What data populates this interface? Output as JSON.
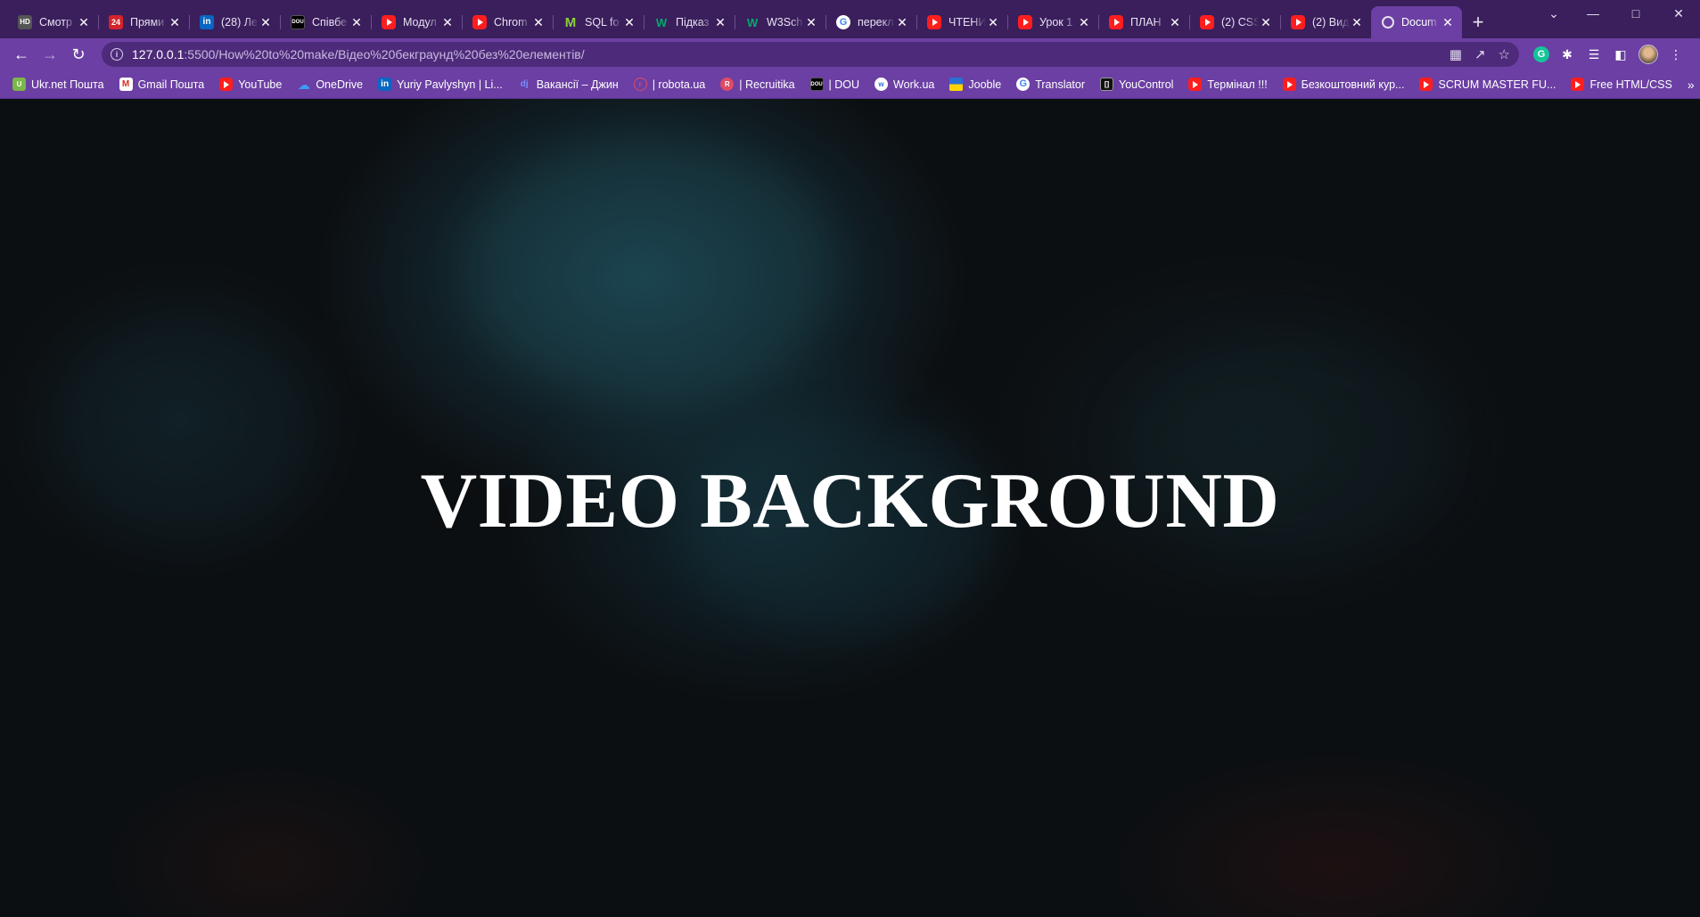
{
  "browser": {
    "tabs": [
      {
        "title": "Смотр",
        "icon": "hd-icon"
      },
      {
        "title": "Прями",
        "icon": "24-icon"
      },
      {
        "title": "(28) Ле",
        "icon": "linkedin-icon"
      },
      {
        "title": "Співбе",
        "icon": "dou-icon"
      },
      {
        "title": "Модул",
        "icon": "youtube-icon"
      },
      {
        "title": "Chrom",
        "icon": "youtube-icon"
      },
      {
        "title": "SQL fo",
        "icon": "sql-icon"
      },
      {
        "title": "Підказ",
        "icon": "w3schools-icon"
      },
      {
        "title": "W3Sch",
        "icon": "w3schools-icon"
      },
      {
        "title": "перекл",
        "icon": "google-icon"
      },
      {
        "title": "ЧТЕНИ",
        "icon": "youtube-icon"
      },
      {
        "title": "Урок 1",
        "icon": "youtube-icon"
      },
      {
        "title": "ПЛАН",
        "icon": "youtube-icon"
      },
      {
        "title": "(2) CSS",
        "icon": "youtube-icon"
      },
      {
        "title": "(2) Вид",
        "icon": "youtube-icon"
      },
      {
        "title": "Docum",
        "icon": "globe-icon",
        "active": true
      }
    ],
    "address": {
      "host": "127.0.0.1",
      "path": ":5500/How%20to%20make/Відео%20бекграунд%20без%20елементів/"
    },
    "bookmarks": [
      {
        "label": "Ukr.net Пошта",
        "icon": "ukrnet-icon"
      },
      {
        "label": "Gmail Пошта",
        "icon": "gmail-icon"
      },
      {
        "label": "YouTube",
        "icon": "youtube-icon"
      },
      {
        "label": "OneDrive",
        "icon": "onedrive-icon"
      },
      {
        "label": "Yuriy Pavlyshyn | Li...",
        "icon": "linkedin-icon"
      },
      {
        "label": "Вакансії – Джин",
        "icon": "djinni-icon"
      },
      {
        "label": "| robota.ua",
        "icon": "robota-icon"
      },
      {
        "label": "| Recruitika",
        "icon": "recruitika-icon"
      },
      {
        "label": "| DOU",
        "icon": "dou-icon"
      },
      {
        "label": "Work.ua",
        "icon": "workua-icon"
      },
      {
        "label": "Jooble",
        "icon": "ukraine-flag-icon"
      },
      {
        "label": "Translator",
        "icon": "google-icon"
      },
      {
        "label": "YouControl",
        "icon": "youcontrol-icon"
      },
      {
        "label": "Термінал !!!",
        "icon": "youtube-icon"
      },
      {
        "label": "Безкоштовний кур...",
        "icon": "youtube-icon"
      },
      {
        "label": "SCRUM MASTER FU...",
        "icon": "youtube-icon"
      },
      {
        "label": "Free HTML/CSS",
        "icon": "youtube-icon"
      }
    ],
    "colors": {
      "frame": "#3a1f5c",
      "toolbar": "#6b3fa3",
      "omnibox": "#4d2b7a"
    }
  },
  "page": {
    "headline": "VIDEO BACKGROUND",
    "background": "dark teal smoke video"
  }
}
